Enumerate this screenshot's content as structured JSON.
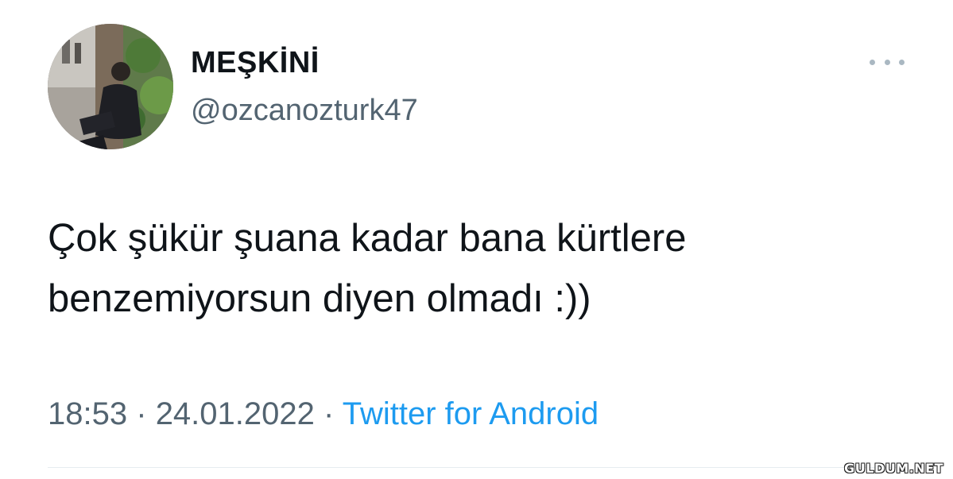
{
  "tweet": {
    "author": {
      "display_name": "MEŞKİNİ",
      "handle": "@ozcanozturk47",
      "avatar": "profile-photo"
    },
    "more_icon": "more-horizontal-icon",
    "text_lines": [
      "Çok şükür şuana kadar bana kürtlere",
      "benzemiyorsun diyen olmadı :))"
    ],
    "time": "18:53",
    "separator": "·",
    "date": "24.01.2022",
    "source": "Twitter for Android"
  },
  "watermark": "GULDUM.NET",
  "colors": {
    "text_primary": "#0f1419",
    "text_secondary": "#536471",
    "link": "#1d9bf0",
    "divider": "#e6ecf0"
  }
}
